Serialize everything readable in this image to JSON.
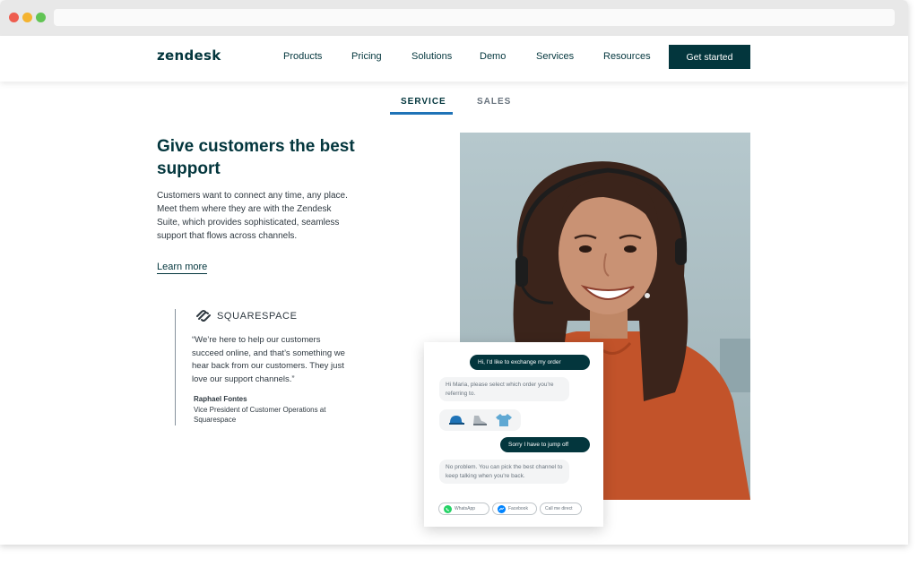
{
  "nav": {
    "logo": "zendesk",
    "links": [
      "Products",
      "Pricing",
      "Solutions",
      "Demo",
      "Services",
      "Resources"
    ],
    "cta": "Get started"
  },
  "tabs": [
    "SERVICE",
    "SALES"
  ],
  "hero": {
    "title": "Give customers the best support",
    "body": "Customers want to connect any time, any place. Meet them where they are with the Zendesk Suite, which provides sophisticated, seamless support that flows across channels.",
    "link": "Learn more"
  },
  "testimonial": {
    "brand": "SQUARESPACE",
    "quote": "“We’re here to help our customers succeed online, and that’s something we hear back from our customers. They just love our support channels.”",
    "author": "Raphael Fontes",
    "role": "Vice President of Customer Operations at Squarespace"
  },
  "chat": {
    "msg1": "Hi, I'd like to exchange my order",
    "reply1": "Hi Maria, please select which order you're referring to.",
    "msg2": "Sorry I have to jump off",
    "reply2": "No problem. You can pick the best channel to keep talking when you're back.",
    "channels": [
      "WhatsApp",
      "Facebook",
      "Call me direct"
    ],
    "products": [
      "cap-icon",
      "shoe-icon",
      "shirt-icon"
    ]
  },
  "colors": {
    "brand": "#03363d",
    "accent": "#1f73b7",
    "whatsapp": "#25d366",
    "messenger": "#0084ff",
    "sweater": "#c2532a"
  }
}
